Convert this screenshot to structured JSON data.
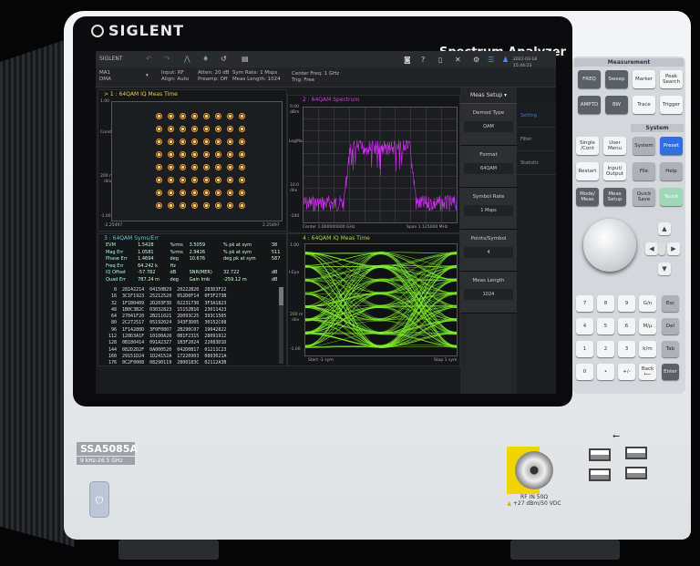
{
  "device": {
    "brand": "SIGLENT",
    "product_type": "Spectrum Analyzer",
    "model": "SSA5085A",
    "range": "9 kHz-26.5 GHz",
    "rf_label": "RF IN 50Ω",
    "rf_limit": "+27 dBm/50 VDC",
    "usb_icon": "usb-icon"
  },
  "toolbar": {
    "brand": "SIGLENT",
    "datetime": "2021-03-18 15:44:23"
  },
  "status": {
    "mode": "MA1",
    "mode2": "DMA",
    "input": "Input: RF",
    "align": "Align: Auto",
    "atten": "Atten: 20 dB",
    "preamp": "Preamp: Off",
    "symrate": "Sym Rate: 1 Msps",
    "measlen": "Meas Length: 1024",
    "center": "Center Freq: 1 GHz",
    "trig": "Trig: Free"
  },
  "win1": {
    "title": "> 1 : 64QAM  IQ Meas Time",
    "ytop": "1.00",
    "ymid": "Const",
    "yscale": "200 m",
    "yunit": "/div",
    "ybot": "-1.00",
    "xmin": "-2.25497",
    "xmax": "2.25497"
  },
  "win2": {
    "title": "2 : 64QAM  Spectrum",
    "ytop": "0.00",
    "ytopunit": "dBm",
    "ymid": "LogMag",
    "yscale": "10.0",
    "yunit": "/div",
    "ybot": "-100",
    "center": "Center 1.000000000 GHz",
    "span": "Span 1.125000 MHz"
  },
  "win3": {
    "title": "3 : 64QAM  Syms/Err",
    "metrics": [
      [
        "EVM",
        "1.5428",
        "%rms",
        "3.5059",
        "% pk at sym",
        "38"
      ],
      [
        "Mag Err",
        "1.0581",
        "%rms",
        "2.9426",
        "% pk at sym",
        "511"
      ],
      [
        "Phase Err",
        "1.4694",
        "deg",
        "10.676",
        "deg pk at sym",
        "587"
      ],
      [
        "Freq Err",
        "64.242 k",
        "Hz",
        "",
        "",
        ""
      ],
      [
        "IQ Offset",
        "-57.782",
        "dB",
        "SNR(MER)",
        "32.722",
        "dB"
      ],
      [
        "Quad Err",
        "787.24 m",
        "deg",
        "Gain Imb",
        "-259.12 m",
        "dB"
      ]
    ],
    "hex": [
      [
        "0",
        "28142214",
        "04150B29",
        "20222B20",
        "283D3F22"
      ],
      [
        "16",
        "3C1F1923",
        "25212520",
        "052D0F14",
        "0F3F273B"
      ],
      [
        "32",
        "1F1B0409",
        "2D203F3D",
        "02231730",
        "3F3A1823"
      ],
      [
        "48",
        "1B0C3B2C",
        "03032823",
        "15152B10",
        "23011423"
      ],
      [
        "64",
        "27041F20",
        "2B211021",
        "2D093C25",
        "393C1505"
      ],
      [
        "80",
        "2C272517",
        "05192024",
        "343F3D05",
        "30152C08"
      ],
      [
        "96",
        "1F14280D",
        "3F0F0807",
        "2B290C07",
        "19042822"
      ],
      [
        "112",
        "120D3A1F",
        "10100A20",
        "0B1F2315",
        "28091912"
      ],
      [
        "128",
        "0B180414",
        "091A2327",
        "1B3F2024",
        "22083D1D"
      ],
      [
        "144",
        "082D2D2F",
        "0A000520",
        "042D0B17",
        "01211C23"
      ],
      [
        "160",
        "29151D24",
        "1D24152A",
        "17220903",
        "0803021A"
      ],
      [
        "176",
        "0C2F0008",
        "08290119",
        "2800183C",
        "02112A3B"
      ]
    ]
  },
  "win4": {
    "title": "4 : 64QAM  IQ Meas Time",
    "ytop": "1.00",
    "ymid": "I-Eye",
    "yscale": "200 m",
    "yunit": "/div",
    "ybot": "-1.00",
    "start": "Start -1 sym",
    "stop": "Stop 1 sym"
  },
  "menu": {
    "header": "Meas Setup",
    "items": [
      {
        "label": "Demod Type",
        "value": "QAM"
      },
      {
        "label": "Format",
        "value": "64QAM"
      },
      {
        "label": "Symbol Rate",
        "value": "1 Msps"
      },
      {
        "label": "Points/Symbol",
        "value": "4"
      },
      {
        "label": "Meas Length",
        "value": "1024"
      }
    ],
    "tabs": [
      "Setting",
      "Filter",
      "Statistic"
    ]
  },
  "keys": {
    "measurement": "Measurement",
    "system": "System",
    "meas": [
      "FREQ",
      "Sweep",
      "Marker",
      "Peak Search",
      "AMPTD",
      "BW",
      "Trace",
      "Trigger"
    ],
    "left": [
      "Single /Cont",
      "User Menu",
      "Restart",
      "Input/ Output",
      "Mode/ Meas",
      "Meas Setup"
    ],
    "sys": [
      "System",
      "Preset",
      "File",
      "Help",
      "Quick Save",
      "Touch"
    ],
    "pad": [
      "7",
      "8",
      "9",
      "G/n",
      "Esc",
      "4",
      "5",
      "6",
      "M/µ",
      "Del",
      "1",
      "2",
      "3",
      "k/m",
      "Tab",
      "0",
      "•",
      "+/-",
      "Back ⟵",
      "Enter"
    ]
  },
  "colors": {
    "win1": "#e8d048",
    "win2": "#d040e0",
    "win3": "#60c8d0",
    "win4": "#a8e030",
    "constellation": "#f0a030",
    "spectrum": "#d030f0",
    "eye": "#7ef02a",
    "preset": "#2f6fe0"
  }
}
